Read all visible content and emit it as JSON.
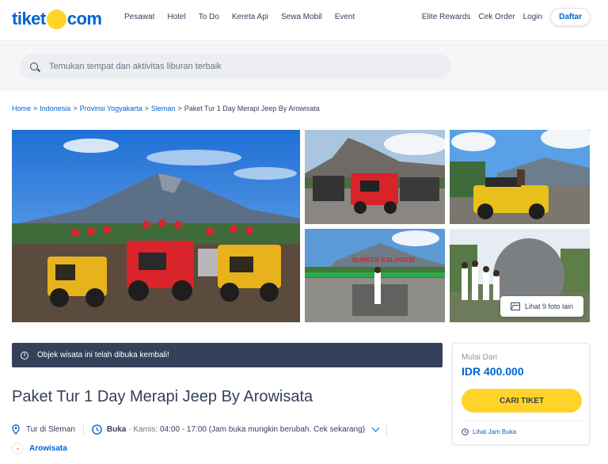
{
  "header": {
    "logo_left": "tiket",
    "logo_right": "com",
    "nav": [
      "Pesawat",
      "Hotel",
      "To Do",
      "Kereta Api",
      "Sewa Mobil",
      "Event"
    ],
    "right_nav": [
      "Elite Rewards",
      "Cek Order",
      "Login"
    ],
    "register_label": "Daftar"
  },
  "search": {
    "placeholder": "Temukan tempat dan aktivitas liburan terbaik"
  },
  "breadcrumb": [
    "Home",
    "Indonesia",
    "Provinsi Yogyakarta",
    "Sleman",
    "Paket Tur 1 Day Merapi Jeep By Arowisata"
  ],
  "gallery": {
    "more_photos_label": "Lihat 9 foto lain",
    "sign_text": "BUNKER KALIADEM"
  },
  "notice": {
    "text": "Objek wisata ini telah dibuka kembali!"
  },
  "product": {
    "title": "Paket Tur 1 Day Merapi Jeep By Arowisata",
    "location": "Tur di Sleman",
    "status": "Buka",
    "day_label": "· Kamis:",
    "hours": "04:00 - 17:00 (Jam buka mungkin berubah. Cek sekarang)",
    "provider_name": "Arowisata"
  },
  "price_card": {
    "label": "Mulai Dari",
    "price": "IDR 400.000",
    "button_label": "CARI TIKET",
    "hours_link": "Lihat Jam Buka"
  },
  "colors": {
    "brand_blue": "#0064d2",
    "brand_yellow": "#ffd32a",
    "dark_navy": "#35405a"
  }
}
